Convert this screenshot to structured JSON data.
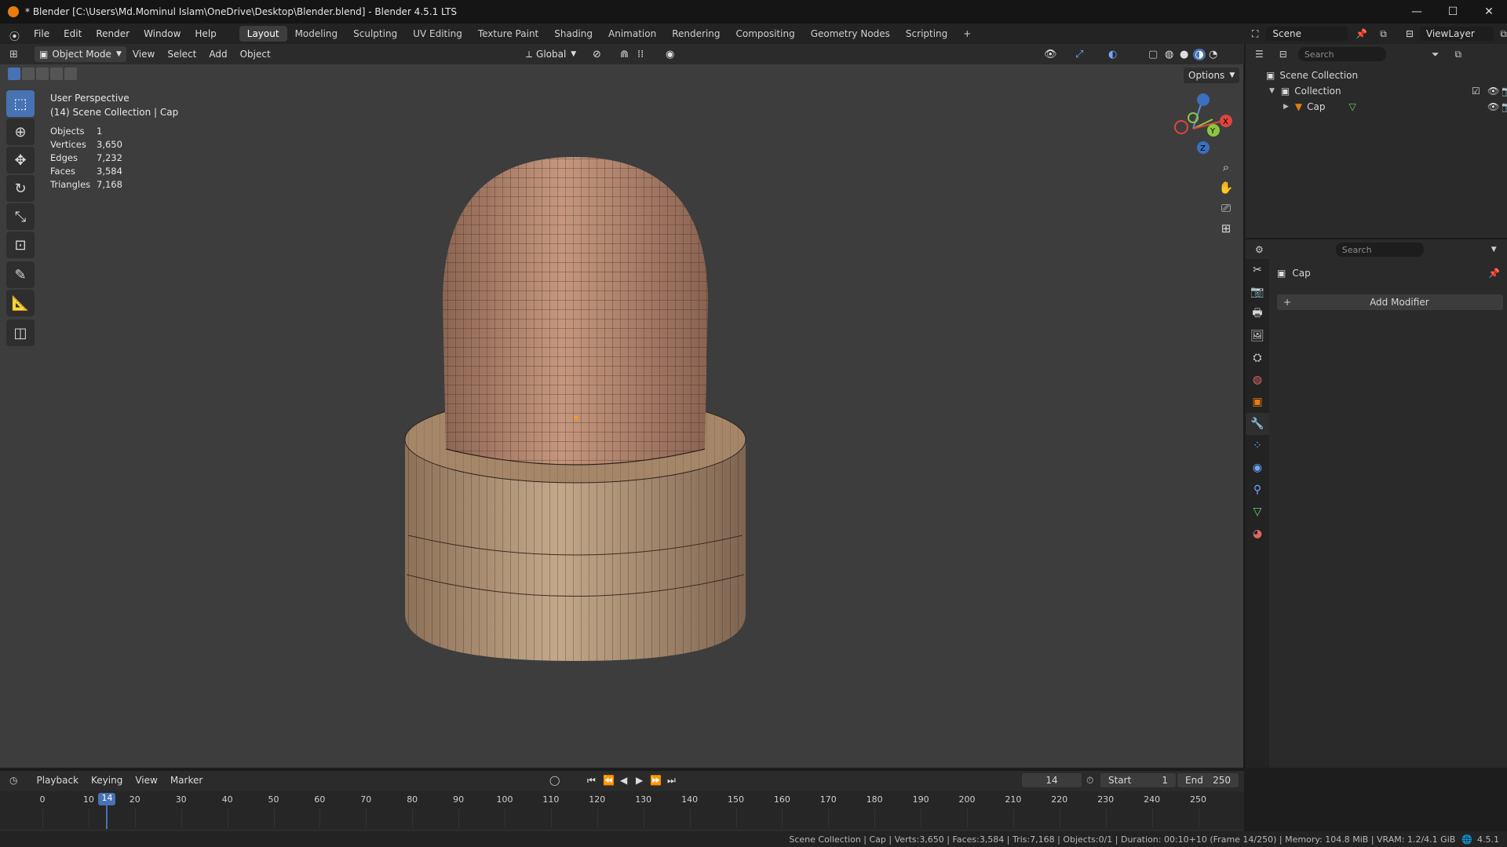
{
  "titlebar": {
    "title": "* Blender [C:\\Users\\Md.Mominul Islam\\OneDrive\\Desktop\\Blender.blend] - Blender 4.5.1 LTS",
    "minimize": "—",
    "maximize": "☐",
    "close": "✕"
  },
  "menubar": {
    "menus": [
      "File",
      "Edit",
      "Render",
      "Window",
      "Help"
    ],
    "workspaces": [
      "Layout",
      "Modeling",
      "Sculpting",
      "UV Editing",
      "Texture Paint",
      "Shading",
      "Animation",
      "Rendering",
      "Compositing",
      "Geometry Nodes",
      "Scripting"
    ],
    "active_workspace": "Layout",
    "add_tab": "+"
  },
  "viewport_header": {
    "mode": "Object Mode",
    "menus": [
      "View",
      "Select",
      "Add",
      "Object"
    ],
    "transform_orientation": "Global",
    "options": "Options"
  },
  "viewport": {
    "perspective": "User Perspective",
    "context": "(14) Scene Collection | Cap",
    "stats": [
      {
        "key": "Objects",
        "value": "1"
      },
      {
        "key": "Vertices",
        "value": "3,650"
      },
      {
        "key": "Edges",
        "value": "7,232"
      },
      {
        "key": "Faces",
        "value": "3,584"
      },
      {
        "key": "Triangles",
        "value": "7,168"
      }
    ],
    "gizmo": {
      "x": "X",
      "y": "Y",
      "z": "Z"
    }
  },
  "outliner": {
    "scene_label": "Scene",
    "viewlayer_label": "ViewLayer",
    "search_placeholder": "Search",
    "scene_collection": "Scene Collection",
    "collection": "Collection",
    "object": "Cap"
  },
  "properties": {
    "search_placeholder": "Search",
    "object_name": "Cap",
    "add_modifier": "Add Modifier"
  },
  "timeline": {
    "menus": [
      "Playback",
      "Keying",
      "View",
      "Marker"
    ],
    "current_frame": "14",
    "start_label": "Start",
    "start_value": "1",
    "end_label": "End",
    "end_value": "250",
    "ruler": [
      "0",
      "10",
      "20",
      "30",
      "40",
      "50",
      "60",
      "70",
      "80",
      "90",
      "100",
      "110",
      "120",
      "130",
      "140",
      "150",
      "160",
      "170",
      "180",
      "190",
      "200",
      "210",
      "220",
      "230",
      "240",
      "250"
    ],
    "playhead": "14"
  },
  "statusbar": {
    "text": "Scene Collection | Cap | Verts:3,650 | Faces:3,584 | Tris:7,168 | Objects:0/1 | Duration: 00:10+10 (Frame 14/250) | Memory: 104.8 MiB | VRAM: 1.2/4.1 GiB",
    "version": "4.5.1"
  },
  "colors": {
    "accent": "#4772b3",
    "object_orange": "#e87d0d",
    "cap_skin": "#b98a72",
    "base_wood": "#b29577"
  }
}
